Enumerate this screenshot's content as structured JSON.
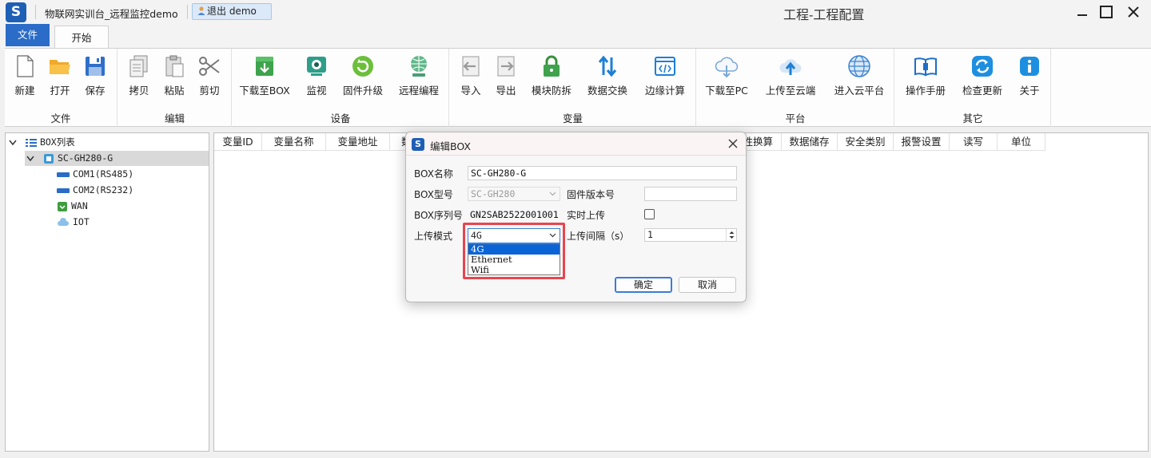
{
  "titlebar": {
    "project_name": "物联网实训台_远程监控demo",
    "logout_label": "退出 demo",
    "window_title": "工程-工程配置"
  },
  "tabs": {
    "file": "文件",
    "start": "开始"
  },
  "ribbon": {
    "groups": {
      "file": "文件",
      "edit": "编辑",
      "device": "设备",
      "variable": "变量",
      "platform": "平台",
      "other": "其它"
    },
    "buttons": {
      "new": "新建",
      "open": "打开",
      "save": "保存",
      "copy": "拷贝",
      "paste": "粘贴",
      "cut": "剪切",
      "download_box": "下载至BOX",
      "monitor": "监视",
      "firmware": "固件升级",
      "remote_prog": "远程编程",
      "import": "导入",
      "export": "导出",
      "module_protect": "模块防拆",
      "data_exchange": "数据交换",
      "edge_compute": "边缘计算",
      "download_pc": "下载至PC",
      "upload_cloud": "上传至云端",
      "enter_cloud": "进入云平台",
      "manual": "操作手册",
      "check_update": "检查更新",
      "about": "关于"
    }
  },
  "tree": {
    "root": "BOX列表",
    "box": "SC-GH280-G",
    "children": [
      "COM1(RS485)",
      "COM2(RS232)",
      "WAN",
      "IOT"
    ]
  },
  "grid": {
    "columns": [
      "变量ID",
      "变量名称",
      "变量地址",
      "数",
      "性换算",
      "数据储存",
      "安全类别",
      "报警设置",
      "读写",
      "单位"
    ]
  },
  "dialog": {
    "title": "编辑BOX",
    "labels": {
      "box_name": "BOX名称",
      "box_model": "BOX型号",
      "fw_version": "固件版本号",
      "box_serial": "BOX序列号",
      "realtime_upload": "实时上传",
      "upload_mode": "上传模式",
      "upload_interval": "上传间隔（s）"
    },
    "values": {
      "box_name": "SC-GH280-G",
      "box_model": "SC-GH280",
      "fw_version": "",
      "box_serial": "GN2SAB2522001001",
      "upload_mode": "4G",
      "upload_interval": "1"
    },
    "upload_mode_options": [
      "4G",
      "Ethernet",
      "Wifi"
    ],
    "ok": "确定",
    "cancel": "取消"
  },
  "colors": {
    "accent": "#2a6cc7",
    "highlight": "#e8454f",
    "selected_option": "#0a64d6"
  }
}
